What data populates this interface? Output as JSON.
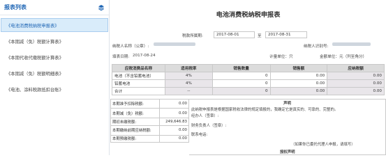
{
  "sidebar": {
    "title": "报表列表",
    "items": [
      {
        "label": "《电池消费税纳税申报表》",
        "active": true
      },
      {
        "label": "《本期减（免）税额计算表》",
        "active": false
      },
      {
        "label": "《本期代收代缴税额计算表》",
        "active": false
      },
      {
        "label": "《本期减（免）税额明细表》",
        "active": false
      },
      {
        "label": "《电池、涂料税款抵扣台账》",
        "active": false
      }
    ]
  },
  "form": {
    "title": "电池消费税纳税申报表",
    "period_label": "税款所属期:",
    "period_start": "2017-08-01",
    "period_to": "至",
    "period_end": "2017-08-31",
    "taxpayer_name_label": "纳税人名称（公章）:",
    "taxpayer_id_label": "纳税人识别号:",
    "fill_date_label": "填表日期:",
    "fill_date": "2017-08-24",
    "unit_label": "计量单位：只",
    "amount_unit_label": "金额单位：元（列至角分）"
  },
  "table": {
    "headers": [
      "应税消费品名称",
      "适用税率",
      "销售数量",
      "销售额",
      "应纳税额"
    ],
    "rows": [
      {
        "name": "电池（不含铅蓄电池）",
        "rate": "4%",
        "qty": "0",
        "sales": "0.00",
        "tax": "0.00"
      },
      {
        "name": "铅蓄电池",
        "rate": "4%",
        "qty": "0",
        "sales": "0.00",
        "tax": "0.00"
      },
      {
        "name": "合计",
        "rate": "--",
        "qty": "0",
        "sales": "0.00",
        "tax": "0.00"
      }
    ]
  },
  "bottom_left": [
    {
      "label": "本期准予扣除税额:",
      "value": "0.00"
    },
    {
      "label": "本期减（免）税额:",
      "value": "0.00"
    },
    {
      "label": "期初未缴税额:",
      "value": "249,646.83"
    },
    {
      "label": "本期缴纳前期应纳税额:",
      "value": "0.00"
    },
    {
      "label": "本期预缴税额:",
      "value": "0.00"
    }
  ],
  "declaration": {
    "title": "声明",
    "text": "此纳税申报表是根据国家税收法律的规定填报的，我确定它是真实的、可靠的、完整的。",
    "operator": "经办人（签章）:",
    "finance": "财务负责人（签章）:",
    "phone": "联系电话:",
    "agent_note": "（如果你已委托代理人申报，请填写）",
    "auth_title": "授权声明"
  }
}
